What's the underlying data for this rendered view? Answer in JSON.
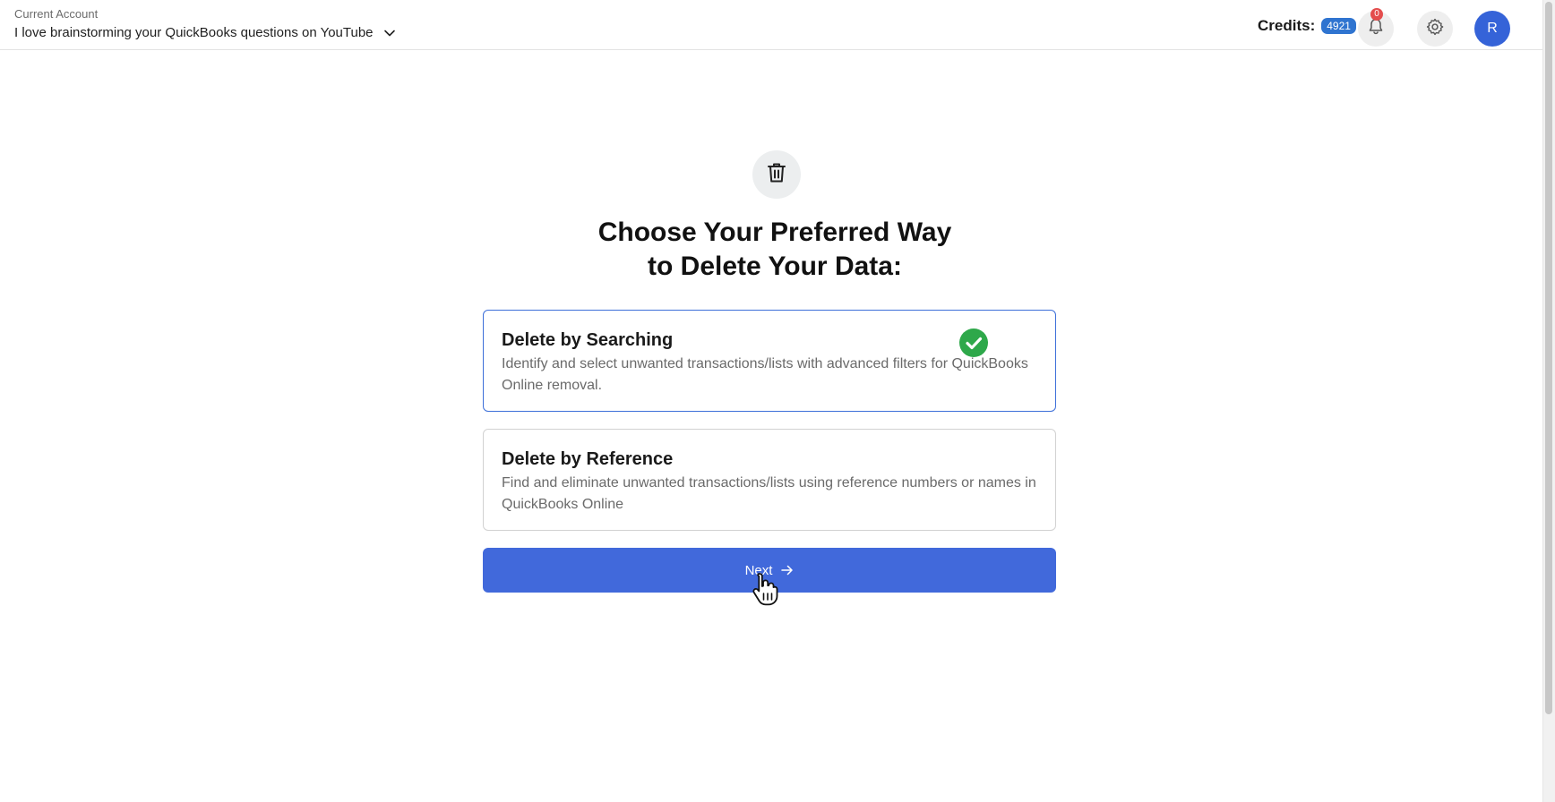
{
  "header": {
    "account_label": "Current Account",
    "account_name": "I love brainstorming your QuickBooks questions on YouTube",
    "credits_label": "Credits:",
    "credits_value": "4921",
    "notification_count": "0",
    "avatar_initial": "R"
  },
  "main": {
    "title_line1": "Choose Your Preferred Way",
    "title_line2": "to Delete Your Data:",
    "options": [
      {
        "title": "Delete by Searching",
        "description": "Identify and select unwanted transactions/lists with advanced filters for QuickBooks Online removal.",
        "selected": true
      },
      {
        "title": "Delete by Reference",
        "description": "Find and eliminate unwanted transactions/lists using reference numbers or names in QuickBooks Online",
        "selected": false
      }
    ],
    "next_label": "Next"
  },
  "colors": {
    "accent": "#4169db",
    "selected_border": "#3d6fd9",
    "check_green": "#2ea84a",
    "badge_blue": "#2f74d0",
    "notification_red": "#e44d4d"
  },
  "icons": [
    "chevron-down-icon",
    "bell-icon",
    "gear-icon",
    "trash-icon",
    "check-circle-icon",
    "arrow-right-icon",
    "hand-cursor-icon"
  ]
}
